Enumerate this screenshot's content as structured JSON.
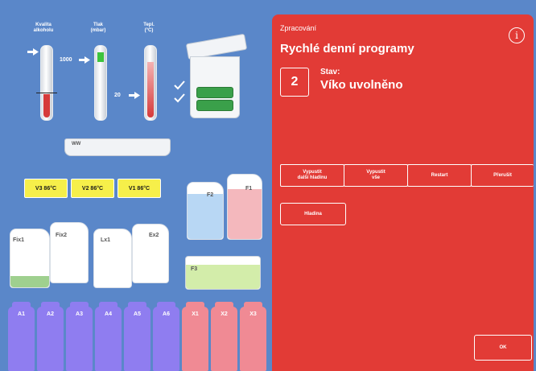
{
  "gauges": {
    "alcohol_header": "Kvalita\nalkoholu",
    "pressure_header": "Tlak\n(mbar)",
    "temp_header": "Tepl.\n(°C)",
    "pressure_mark_high": "1000",
    "pressure_mark_low": "20"
  },
  "ww_label": "WW",
  "v_tags": [
    {
      "label": "V3  86°C"
    },
    {
      "label": "V2  86°C"
    },
    {
      "label": "V1  86°C"
    }
  ],
  "jugs": {
    "f2": "F2",
    "f1": "F1",
    "fix1": "Fix1",
    "fix2": "Fix2",
    "lx1": "Lx1",
    "ex2": "Ex2",
    "f3": "F3"
  },
  "bottles": [
    {
      "label": "A1",
      "color": "#8f7df0"
    },
    {
      "label": "A2",
      "color": "#8f7df0"
    },
    {
      "label": "A3",
      "color": "#8f7df0"
    },
    {
      "label": "A4",
      "color": "#8f7df0"
    },
    {
      "label": "A5",
      "color": "#8f7df0"
    },
    {
      "label": "A6",
      "color": "#8f7df0"
    },
    {
      "label": "X1",
      "color": "#f08a94"
    },
    {
      "label": "X2",
      "color": "#f08a94"
    },
    {
      "label": "X3",
      "color": "#f08a94"
    }
  ],
  "panel": {
    "section": "Zpracování",
    "title": "Rychlé denní programy",
    "step_number": "2",
    "status_label": "Stav:",
    "status_value": "Víko uvolněno",
    "buttons": {
      "drain_next": "Vypustit\ndalší hladinu",
      "drain_all": "Vypustit\nvše",
      "restart": "Restart",
      "abort": "Přerušit",
      "level": "Hladina",
      "ok": "OK"
    },
    "info_icon": "i"
  }
}
